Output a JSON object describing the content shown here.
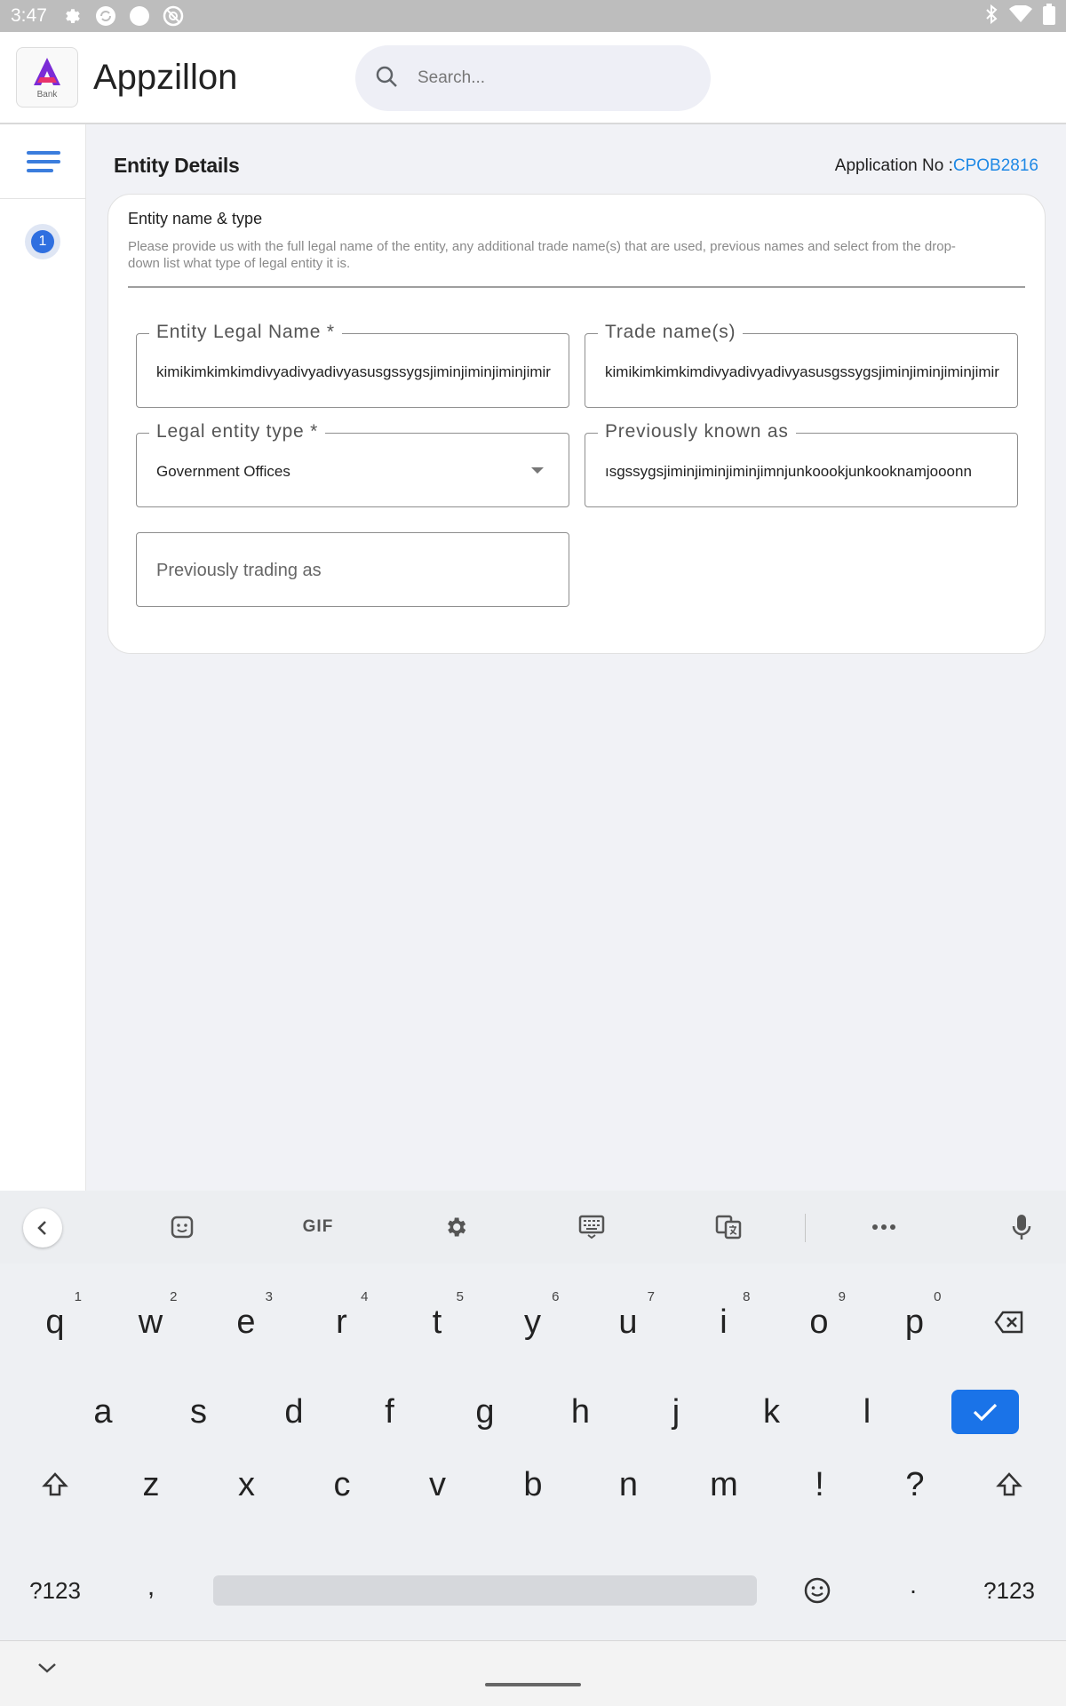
{
  "status_bar": {
    "time": "3:47"
  },
  "header": {
    "logo_sub": "Bank",
    "app_title": "Appzillon",
    "search_placeholder": "Search..."
  },
  "sidebar": {
    "step_number": "1"
  },
  "main": {
    "page_title": "Entity Details",
    "app_no_label": "Application No :",
    "app_no_value": "CPOB2816"
  },
  "card": {
    "title": "Entity name & type",
    "description": "Please provide us with the full legal name of the entity, any additional trade name(s) that are used, previous names and select from the drop-down list what type of legal entity it is.",
    "fields": {
      "entity_legal_name": {
        "label": "Entity Legal Name *",
        "value": "kimikimkimkimdivyadivyadivyasusgssygsjiminjiminjiminjimir"
      },
      "trade_names": {
        "label": "Trade name(s)",
        "value": "kimikimkimkimdivyadivyadivyasusgssygsjiminjiminjiminjimir"
      },
      "legal_entity_type": {
        "label": "Legal entity type *",
        "value": "Government Offices"
      },
      "previously_known_as": {
        "label": "Previously known as",
        "value": "ısgssygsjiminjiminjiminjimnjunkoookjunkooknamjooonn"
      },
      "previously_trading_as": {
        "placeholder": "Previously trading as"
      }
    }
  },
  "keyboard": {
    "toolbar": {
      "gif": "GIF"
    },
    "row1": [
      {
        "k": "q",
        "n": "1"
      },
      {
        "k": "w",
        "n": "2"
      },
      {
        "k": "e",
        "n": "3"
      },
      {
        "k": "r",
        "n": "4"
      },
      {
        "k": "t",
        "n": "5"
      },
      {
        "k": "y",
        "n": "6"
      },
      {
        "k": "u",
        "n": "7"
      },
      {
        "k": "i",
        "n": "8"
      },
      {
        "k": "o",
        "n": "9"
      },
      {
        "k": "p",
        "n": "0"
      }
    ],
    "row2": [
      "a",
      "s",
      "d",
      "f",
      "g",
      "h",
      "j",
      "k",
      "l"
    ],
    "row3": [
      "z",
      "x",
      "c",
      "v",
      "b",
      "n",
      "m",
      "!",
      "?"
    ],
    "row4": {
      "sym_left": "?123",
      "comma": ",",
      "period": ".",
      "sym_right": "?123"
    }
  },
  "colors": {
    "accent": "#1e88e5",
    "enter_key": "#1a73e8",
    "step_badge": "#2f6fe0",
    "menu_icon": "#3b7ddd"
  }
}
